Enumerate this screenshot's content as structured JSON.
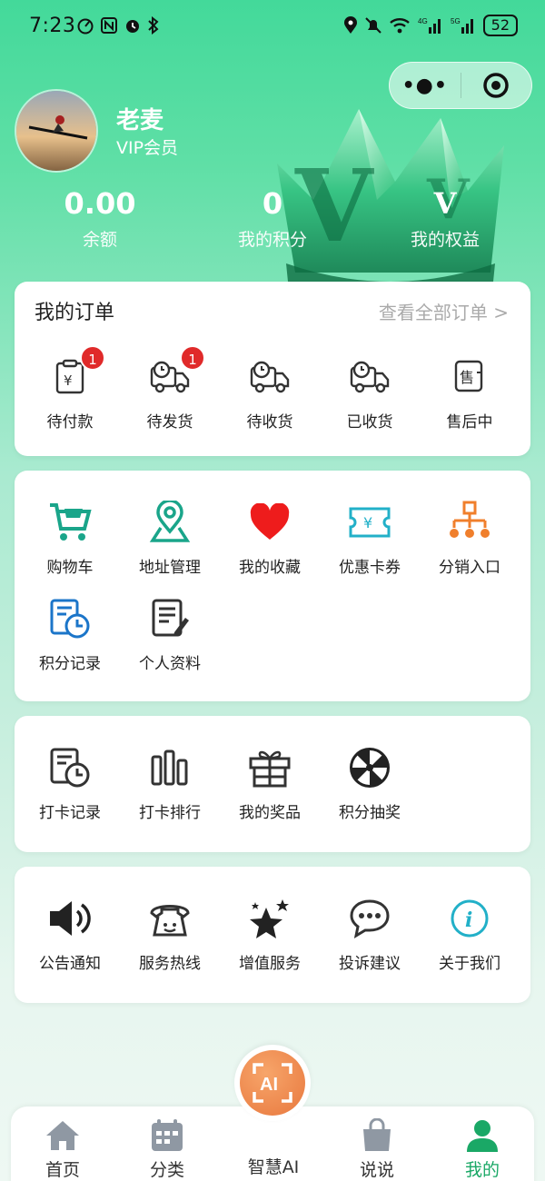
{
  "status": {
    "time": "7:23",
    "battery": "52"
  },
  "profile": {
    "name": "老麦",
    "level": "VIP会员"
  },
  "stats": [
    {
      "value": "0.00",
      "label": "余额"
    },
    {
      "value": "0",
      "label": "我的积分"
    },
    {
      "value": "V",
      "label": "我的权益"
    }
  ],
  "orders": {
    "title": "我的订单",
    "view_all": "查看全部订单 >",
    "items": [
      {
        "label": "待付款",
        "icon": "payment-pending-icon",
        "badge": "1"
      },
      {
        "label": "待发货",
        "icon": "truck-clock-icon",
        "badge": "1"
      },
      {
        "label": "待收货",
        "icon": "truck-clock-icon"
      },
      {
        "label": "已收货",
        "icon": "truck-check-icon"
      },
      {
        "label": "售后中",
        "icon": "after-sale-icon"
      }
    ]
  },
  "tools": [
    {
      "label": "购物车",
      "icon": "cart-icon",
      "color": "#1aa58a"
    },
    {
      "label": "地址管理",
      "icon": "map-pin-icon",
      "color": "#1aa58a"
    },
    {
      "label": "我的收藏",
      "icon": "heart-icon",
      "color": "#ee1c1c"
    },
    {
      "label": "优惠卡券",
      "icon": "coupon-icon",
      "color": "#22b0c8"
    },
    {
      "label": "分销入口",
      "icon": "org-tree-icon",
      "color": "#f07f2c"
    },
    {
      "label": "积分记录",
      "icon": "points-record-icon",
      "color": "#1b75c9"
    },
    {
      "label": "个人资料",
      "icon": "profile-doc-icon",
      "color": "#333333"
    }
  ],
  "checkin": [
    {
      "label": "打卡记录",
      "icon": "checkin-record-icon"
    },
    {
      "label": "打卡排行",
      "icon": "ranking-bars-icon"
    },
    {
      "label": "我的奖品",
      "icon": "gift-box-icon"
    },
    {
      "label": "积分抽奖",
      "icon": "lottery-wheel-icon"
    }
  ],
  "services": [
    {
      "label": "公告通知",
      "icon": "speaker-icon"
    },
    {
      "label": "服务热线",
      "icon": "phone-icon"
    },
    {
      "label": "增值服务",
      "icon": "stars-icon"
    },
    {
      "label": "投诉建议",
      "icon": "chat-bubble-icon"
    },
    {
      "label": "关于我们",
      "icon": "info-icon",
      "color": "#22b0c8"
    }
  ],
  "tabbar": [
    {
      "label": "首页",
      "icon": "home-icon"
    },
    {
      "label": "分类",
      "icon": "calendar-grid-icon"
    },
    {
      "label": "智慧AI",
      "icon": "ai-icon"
    },
    {
      "label": "说说",
      "icon": "bag-icon"
    },
    {
      "label": "我的",
      "icon": "user-icon",
      "active": true
    }
  ],
  "colors": {
    "accent": "#1aa866",
    "badge": "#e02a2a",
    "ai": "#e8783e"
  }
}
